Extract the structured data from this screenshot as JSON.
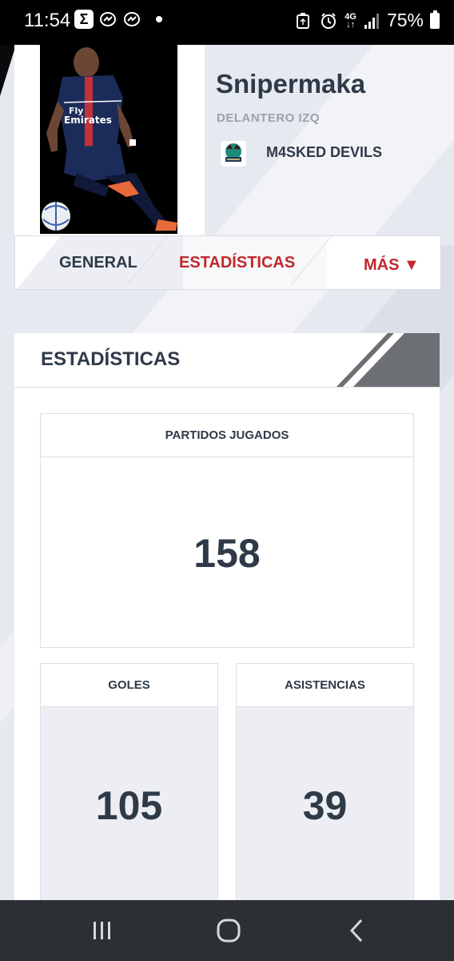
{
  "status_bar": {
    "time": "11:54",
    "network": "4G",
    "battery": "75%",
    "left_icons": [
      "sigma-app-icon",
      "messenger-icon",
      "messenger-icon",
      "notification-dot"
    ],
    "right_icons": [
      "recycle-icon",
      "alarm-icon",
      "network-4g-icon",
      "signal-icon",
      "battery-icon"
    ]
  },
  "profile": {
    "name": "Snipermaka",
    "position": "DELANTERO IZQ",
    "team": "M4SKED DEVILS",
    "photo_icon": "player-photo",
    "team_logo_icon": "team-logo"
  },
  "tabs": [
    {
      "label": "GENERAL",
      "active": false
    },
    {
      "label": "ESTADÍSTICAS",
      "active": true
    },
    {
      "label": "MÁS ▼",
      "active": false
    }
  ],
  "stats": {
    "title": "ESTADÍSTICAS",
    "partidos": {
      "label": "PARTIDOS JUGADOS",
      "value": "158"
    },
    "goles": {
      "label": "GOLES",
      "value": "105"
    },
    "asistencias": {
      "label": "ASISTENCIAS",
      "value": "39"
    }
  },
  "nav_bar": {
    "icons": [
      "recents-icon",
      "home-icon",
      "back-icon"
    ]
  },
  "colors": {
    "accent_red": "#c0282d",
    "text_dark": "#2e3a48",
    "text_muted": "#9aa1ab",
    "background": "#e7e9f0",
    "status_bar": "#000000",
    "nav_bar": "#2c2f33"
  }
}
